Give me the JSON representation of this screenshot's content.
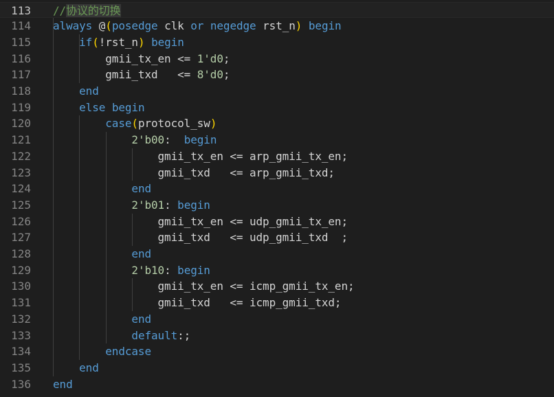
{
  "editor": {
    "current_line": 113,
    "colors": {
      "background": "#1e1e1e",
      "line_number": "#858585",
      "keyword": "#569cd6",
      "identifier": "#d4d4d4",
      "number": "#b5cea8",
      "comment": "#6a9955",
      "bracket": "#ffd700"
    },
    "lines": [
      {
        "num": "113",
        "tokens": [
          {
            "t": "//",
            "c": "cmt"
          },
          {
            "t": "协议的切换",
            "c": "ch"
          }
        ]
      },
      {
        "num": "114",
        "tokens": [
          {
            "t": "always",
            "c": "kw"
          },
          {
            "t": " @",
            "c": "id"
          },
          {
            "t": "(",
            "c": "br1"
          },
          {
            "t": "posedge",
            "c": "kw"
          },
          {
            "t": " clk ",
            "c": "id"
          },
          {
            "t": "or",
            "c": "kw"
          },
          {
            "t": " ",
            "c": "id"
          },
          {
            "t": "negedge",
            "c": "kw"
          },
          {
            "t": " rst_n",
            "c": "id"
          },
          {
            "t": ")",
            "c": "br1"
          },
          {
            "t": " ",
            "c": "id"
          },
          {
            "t": "begin",
            "c": "kw"
          }
        ]
      },
      {
        "num": "115",
        "tokens": [
          {
            "t": "    ",
            "c": "id"
          },
          {
            "t": "if",
            "c": "kw"
          },
          {
            "t": "(",
            "c": "br1"
          },
          {
            "t": "!rst_n",
            "c": "id"
          },
          {
            "t": ")",
            "c": "br1"
          },
          {
            "t": " ",
            "c": "id"
          },
          {
            "t": "begin",
            "c": "kw"
          }
        ]
      },
      {
        "num": "116",
        "tokens": [
          {
            "t": "        gmii_tx_en <= ",
            "c": "id"
          },
          {
            "t": "1'd0",
            "c": "num"
          },
          {
            "t": ";",
            "c": "id"
          }
        ]
      },
      {
        "num": "117",
        "tokens": [
          {
            "t": "        gmii_txd   <= ",
            "c": "id"
          },
          {
            "t": "8'd0",
            "c": "num"
          },
          {
            "t": ";",
            "c": "id"
          }
        ]
      },
      {
        "num": "118",
        "tokens": [
          {
            "t": "    ",
            "c": "id"
          },
          {
            "t": "end",
            "c": "kw"
          }
        ]
      },
      {
        "num": "119",
        "tokens": [
          {
            "t": "    ",
            "c": "id"
          },
          {
            "t": "else",
            "c": "kw"
          },
          {
            "t": " ",
            "c": "id"
          },
          {
            "t": "begin",
            "c": "kw"
          }
        ]
      },
      {
        "num": "120",
        "tokens": [
          {
            "t": "        ",
            "c": "id"
          },
          {
            "t": "case",
            "c": "kw"
          },
          {
            "t": "(",
            "c": "br1"
          },
          {
            "t": "protocol_sw",
            "c": "id"
          },
          {
            "t": ")",
            "c": "br1"
          }
        ]
      },
      {
        "num": "121",
        "tokens": [
          {
            "t": "            ",
            "c": "id"
          },
          {
            "t": "2'b00",
            "c": "num"
          },
          {
            "t": ":  ",
            "c": "id"
          },
          {
            "t": "begin",
            "c": "kw"
          }
        ]
      },
      {
        "num": "122",
        "tokens": [
          {
            "t": "                gmii_tx_en <= arp_gmii_tx_en;",
            "c": "id"
          }
        ]
      },
      {
        "num": "123",
        "tokens": [
          {
            "t": "                gmii_txd   <= arp_gmii_txd;",
            "c": "id"
          }
        ]
      },
      {
        "num": "124",
        "tokens": [
          {
            "t": "            ",
            "c": "id"
          },
          {
            "t": "end",
            "c": "kw"
          }
        ]
      },
      {
        "num": "125",
        "tokens": [
          {
            "t": "            ",
            "c": "id"
          },
          {
            "t": "2'b01",
            "c": "num"
          },
          {
            "t": ": ",
            "c": "id"
          },
          {
            "t": "begin",
            "c": "kw"
          }
        ]
      },
      {
        "num": "126",
        "tokens": [
          {
            "t": "                gmii_tx_en <= udp_gmii_tx_en;",
            "c": "id"
          }
        ]
      },
      {
        "num": "127",
        "tokens": [
          {
            "t": "                gmii_txd   <= udp_gmii_txd  ;",
            "c": "id"
          }
        ]
      },
      {
        "num": "128",
        "tokens": [
          {
            "t": "            ",
            "c": "id"
          },
          {
            "t": "end",
            "c": "kw"
          }
        ]
      },
      {
        "num": "129",
        "tokens": [
          {
            "t": "            ",
            "c": "id"
          },
          {
            "t": "2'b10",
            "c": "num"
          },
          {
            "t": ": ",
            "c": "id"
          },
          {
            "t": "begin",
            "c": "kw"
          }
        ]
      },
      {
        "num": "130",
        "tokens": [
          {
            "t": "                gmii_tx_en <= icmp_gmii_tx_en;",
            "c": "id"
          }
        ]
      },
      {
        "num": "131",
        "tokens": [
          {
            "t": "                gmii_txd   <= icmp_gmii_txd;",
            "c": "id"
          }
        ]
      },
      {
        "num": "132",
        "tokens": [
          {
            "t": "            ",
            "c": "id"
          },
          {
            "t": "end",
            "c": "kw"
          }
        ]
      },
      {
        "num": "133",
        "tokens": [
          {
            "t": "            ",
            "c": "id"
          },
          {
            "t": "default",
            "c": "kw"
          },
          {
            "t": ":;",
            "c": "id"
          }
        ]
      },
      {
        "num": "134",
        "tokens": [
          {
            "t": "        ",
            "c": "id"
          },
          {
            "t": "endcase",
            "c": "kw"
          }
        ]
      },
      {
        "num": "135",
        "tokens": [
          {
            "t": "    ",
            "c": "id"
          },
          {
            "t": "end",
            "c": "kw"
          }
        ]
      },
      {
        "num": "136",
        "tokens": [
          {
            "t": "end",
            "c": "kw"
          }
        ]
      }
    ]
  }
}
